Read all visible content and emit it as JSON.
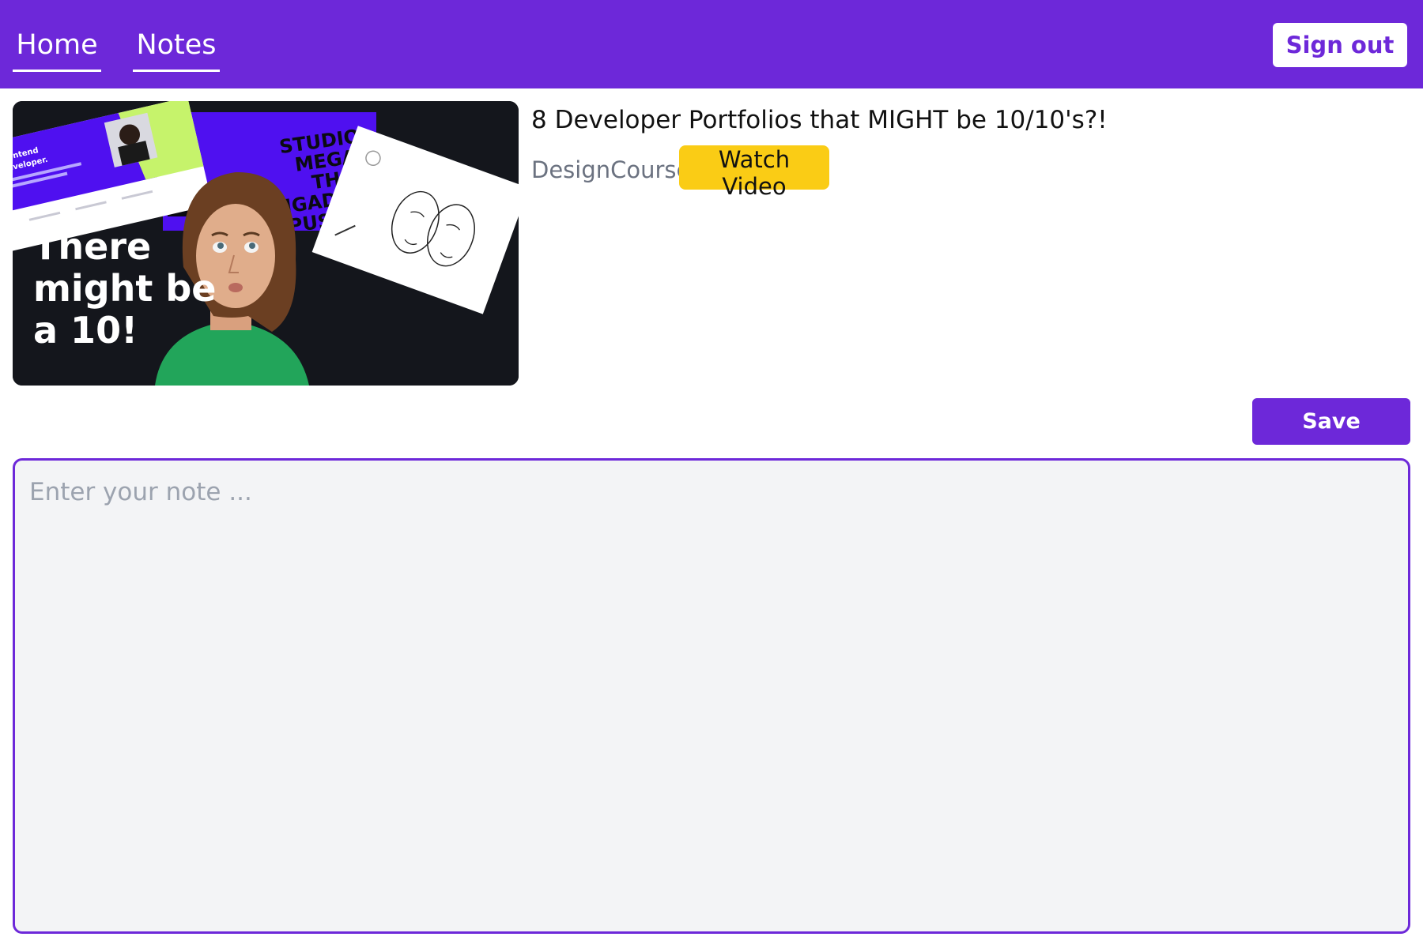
{
  "nav": {
    "home_label": "Home",
    "notes_label": "Notes",
    "signout_label": "Sign out"
  },
  "video": {
    "title": "8 Developer Portfolios that MIGHT be 10/10's?!",
    "channel": "DesignCourse",
    "watch_label": "Watch Video",
    "thumbnail": {
      "headline_line1": "There",
      "headline_line2": "might be",
      "headline_line3": "a 10!",
      "card_text_1": "Frontend",
      "card_text_2": "Developer.",
      "poster_text_1": "STUDIO",
      "poster_text_2": "MEGA",
      "poster_text_3": "THE",
      "poster_text_4": "BRIGADE",
      "poster_text_5": "PUSH"
    }
  },
  "editor": {
    "save_label": "Save",
    "note_placeholder": "Enter your note ...",
    "note_value": ""
  },
  "colors": {
    "brand": "#6d28d9",
    "accent_yellow": "#facc15",
    "editor_bg": "#f3f4f6"
  }
}
